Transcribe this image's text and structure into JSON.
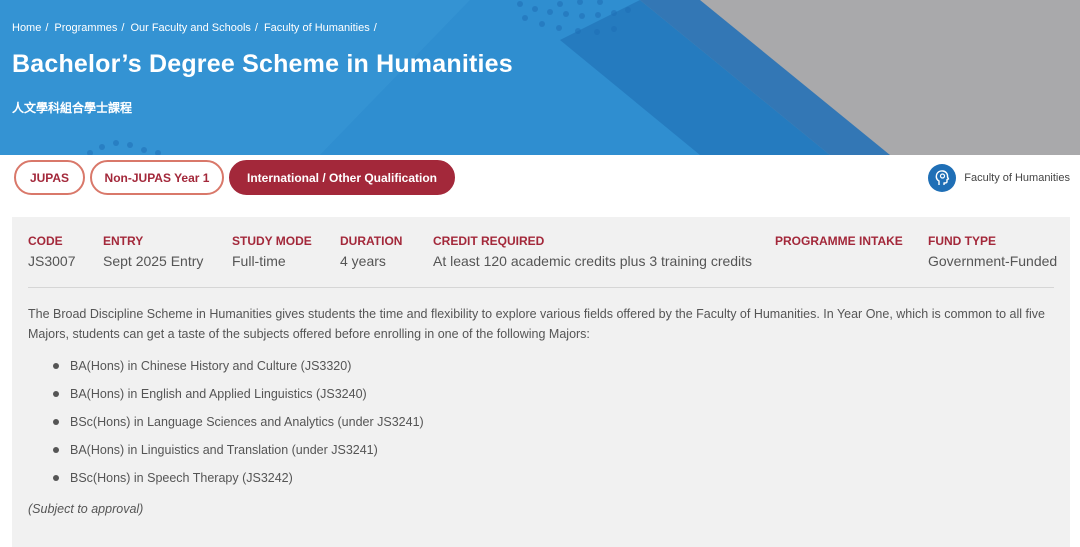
{
  "breadcrumb": [
    "Home",
    "Programmes",
    "Our Faculty and Schools",
    "Faculty of Humanities"
  ],
  "breadcrumb_separator": "/",
  "title": "Bachelor’s Degree Scheme in Humanities",
  "subtitle": "人文學科組合學士課程",
  "tabs": [
    {
      "label": "JUPAS",
      "active": false
    },
    {
      "label": "Non-JUPAS Year 1",
      "active": false
    },
    {
      "label": "International / Other Qualification",
      "active": true
    }
  ],
  "faculty_link": {
    "label": "Faculty of Humanities",
    "icon": "head-profile-icon"
  },
  "info": {
    "code": {
      "label": "CODE",
      "value": "JS3007"
    },
    "entry": {
      "label": "ENTRY",
      "value": "Sept 2025 Entry"
    },
    "study_mode": {
      "label": "STUDY MODE",
      "value": "Full-time"
    },
    "duration": {
      "label": "DURATION",
      "value": "4 years"
    },
    "credit": {
      "label": "CREDIT REQUIRED",
      "value": "At least 120 academic credits plus 3 training credits"
    },
    "intake": {
      "label": "PROGRAMME INTAKE",
      "value": ""
    },
    "fund": {
      "label": "FUND TYPE",
      "value": "Government-Funded"
    }
  },
  "description": "The Broad Discipline Scheme in Humanities gives students the time and flexibility to explore various fields offered by the Faculty of Humanities. In Year One, which is common to all five Majors, students can get a taste of the subjects offered before enrolling in one of the following Majors:",
  "majors": [
    "BA(Hons) in Chinese History and Culture (JS3320)",
    "BA(Hons) in English and Applied Linguistics (JS3240)",
    "BSc(Hons) in Language Sciences and Analytics (under JS3241)",
    "BA(Hons) in Linguistics and Translation (under JS3241)",
    "BSc(Hons) in Speech Therapy (JS3242)"
  ],
  "note": "(Subject to approval)",
  "colors": {
    "accent": "#a3283a",
    "hero_blue": "#2f8ed0",
    "hero_grey": "#a9a9ab"
  }
}
